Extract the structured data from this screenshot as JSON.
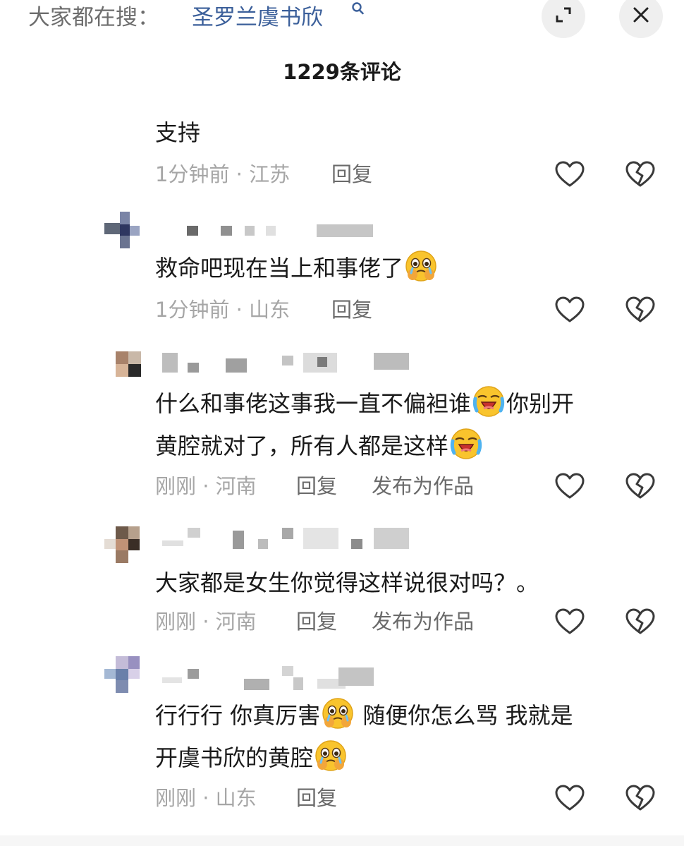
{
  "search": {
    "prefix": "大家都在搜：",
    "term": "圣罗兰虞书欣",
    "term_icon": "search-icon"
  },
  "header": {
    "count_title": "1229条评论",
    "expand_icon": "expand-icon",
    "close_icon": "close-icon"
  },
  "comments": [
    {
      "text": "支持",
      "time_location": "1分钟前 · 江苏",
      "reply": "回复"
    },
    {
      "text": "救命吧现在当上和事佬了",
      "emoji": "crying-pleading-emoji",
      "time_location": "1分钟前 · 山东",
      "reply": "回复"
    },
    {
      "line1_a": "什么和事佬这事我一直不偏袒谁",
      "line1_b": "你别开",
      "line2": "黄腔就对了，所有人都是这样",
      "emoji": "loudly-crying-emoji",
      "time_location": "刚刚 · 河南",
      "reply": "回复",
      "publish": "发布为作品"
    },
    {
      "text": "大家都是女生你觉得这样说很对吗？。",
      "time_location": "刚刚 · 河南",
      "reply": "回复",
      "publish": "发布为作品"
    },
    {
      "line1_a": "行行行 你真厉害",
      "line1_b": " 随便你怎么骂 我就是",
      "line2": "开虞书欣的黄腔",
      "emoji": "crying-pleading-emoji",
      "time_location": "刚刚 · 山东",
      "reply": "回复"
    }
  ],
  "icons": {
    "like": "heart-icon",
    "dislike": "broken-heart-icon"
  },
  "colors": {
    "search_term": "#3b5f9a",
    "meta_gray": "#a6a6a6",
    "text": "#1a1a1a"
  }
}
